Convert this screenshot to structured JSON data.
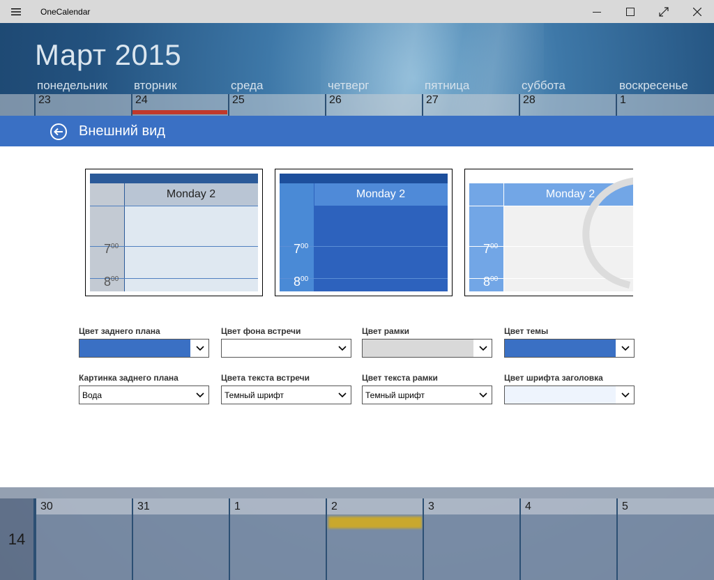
{
  "window": {
    "title": "OneCalendar",
    "controls": [
      "minimize",
      "maximize",
      "fullscreen",
      "close"
    ]
  },
  "calendar": {
    "month_title": "Март 2015",
    "weekdays": [
      "понедельник",
      "вторник",
      "среда",
      "четверг",
      "пятница",
      "суббота",
      "воскресенье"
    ],
    "top_dates": [
      "23",
      "24",
      "25",
      "26",
      "27",
      "28",
      "1"
    ],
    "bottom_week_number": "14",
    "bottom_dates": [
      "30",
      "31",
      "1",
      "2",
      "3",
      "4",
      "5"
    ],
    "today_color": "#c0392b"
  },
  "panel": {
    "title": "Внешний вид",
    "accent_color": "#3a70c4"
  },
  "previews": [
    {
      "day_label": "Monday 2",
      "time1": "7",
      "time2": "8",
      "minutes": "00",
      "theme": "light-blue"
    },
    {
      "day_label": "Monday 2",
      "time1": "7",
      "time2": "8",
      "minutes": "00",
      "theme": "dark-blue"
    },
    {
      "day_label": "Monday 2",
      "time1": "7",
      "time2": "8",
      "minutes": "00",
      "theme": "white"
    }
  ],
  "settings": {
    "row1": [
      {
        "label": "Цвет заднего плана",
        "value": "",
        "swatch": "#3a70c4"
      },
      {
        "label": "Цвет фона встречи",
        "value": "",
        "swatch": "#ffffff"
      },
      {
        "label": "Цвет рамки",
        "value": "",
        "swatch": "#d9d9d9"
      },
      {
        "label": "Цвет темы",
        "value": "",
        "swatch": "#3a70c4"
      }
    ],
    "row2": [
      {
        "label": "Картинка заднего плана",
        "value": "Вода",
        "swatch": "#ffffff"
      },
      {
        "label": "Цвета текста встречи",
        "value": "Темный шрифт",
        "swatch": "#ffffff"
      },
      {
        "label": "Цвет текста рамки",
        "value": "Темный шрифт",
        "swatch": "#ffffff"
      },
      {
        "label": "Цвет шрифта заголовка",
        "value": "",
        "swatch": "#eef4fd"
      }
    ]
  }
}
